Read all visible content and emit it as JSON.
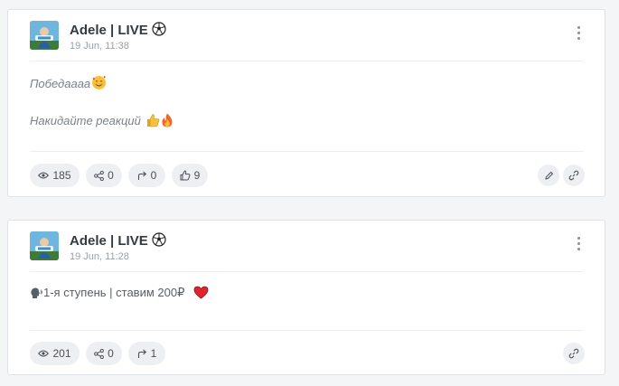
{
  "posts": [
    {
      "author": "Adele | LIVE",
      "date": "19 Jun, 11:38",
      "text_line1": "Победаааа",
      "text_line2": "Накидайте реакций",
      "views": "185",
      "shares": "0",
      "forwards": "0",
      "reactions": "9"
    },
    {
      "author": "Adele | LIVE",
      "date": "19 Jun, 11:28",
      "text_line1": "1-я ступень | ставим 200₽",
      "views": "201",
      "shares": "0",
      "forwards": "1"
    }
  ],
  "icons": {
    "author_badge": "soccer-ball-icon",
    "views": "eye-icon",
    "shares": "share-icon",
    "forwards": "forward-arrow-icon",
    "reactions": "thumbs-up-icon",
    "edit": "pencil-icon",
    "link": "link-icon",
    "menu": "more-vertical-icon"
  },
  "colors": {
    "card_bg": "#ffffff",
    "page_bg": "#f4f5f7",
    "pill_bg": "#edeff2",
    "date_gray": "#9aa0a6"
  }
}
